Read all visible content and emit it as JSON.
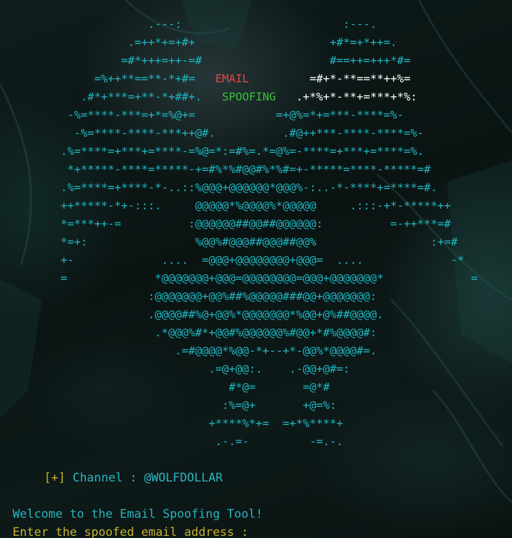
{
  "terminal": {
    "art_lines": [
      {
        "parts": [
          {
            "text": "                      .---:                        :---.",
            "cls": ""
          }
        ]
      },
      {
        "parts": [
          {
            "text": "                   .=++*+=+#+                    +#*=+*++=.",
            "cls": ""
          }
        ]
      },
      {
        "parts": [
          {
            "text": "                  =#*+++=++-=#                   #==++=+++*#=",
            "cls": ""
          }
        ]
      },
      {
        "parts": [
          {
            "text": "              =%++**==**-*+#=   ",
            "cls": ""
          },
          {
            "text": "EMAIL",
            "cls": "red"
          },
          {
            "text": "         ",
            "cls": ""
          },
          {
            "text": "=#+*-**==**++%=",
            "cls": "white"
          }
        ]
      },
      {
        "parts": [
          {
            "text": "            .#*+***=+**-*+##+.   ",
            "cls": ""
          },
          {
            "text": "SPOOFING",
            "cls": "green"
          },
          {
            "text": "   ",
            "cls": ""
          },
          {
            "text": ".+*%+*-**+=***+*%:",
            "cls": "white"
          }
        ]
      },
      {
        "parts": [
          {
            "text": "          -%=****-***=+*=%@+=            =+@%=*+=***-****=%-",
            "cls": ""
          }
        ]
      },
      {
        "parts": [
          {
            "text": "           -%=****-****-***++@#.          .#@++***-****-****=%-",
            "cls": ""
          }
        ]
      },
      {
        "parts": [
          {
            "text": "         .%=****=+***+=****-=%@=*:=#%=.*=@%=-****=+***+=****=%.",
            "cls": ""
          }
        ]
      },
      {
        "parts": [
          {
            "text": "          *+*****-****=*****-+=#%*%#@@#%*%#=+-*****=****-*****=#",
            "cls": ""
          }
        ]
      },
      {
        "parts": [
          {
            "text": "         .%=****=+****-*-..::%@@@+@@@@@@*@@@%-:..-*-****+=****=#.",
            "cls": ""
          }
        ]
      },
      {
        "parts": [
          {
            "text": "         ++*****-*+-:::.     @@@@@*%@@@@%*@@@@@     .:::-+*-*****++",
            "cls": ""
          }
        ]
      },
      {
        "parts": [
          {
            "text": "         *=***++-=          :@@@@@@##@@##@@@@@@:          =-++***=#",
            "cls": ""
          }
        ]
      },
      {
        "parts": [
          {
            "text": "         *=+:                %@@%#@@@##@@@##@@%                 :+=#",
            "cls": ""
          }
        ]
      },
      {
        "parts": [
          {
            "text": "         +-             ....  =@@@+@@@@@@@@+@@@=  ....             -*",
            "cls": ""
          }
        ]
      },
      {
        "parts": [
          {
            "text": "         =             *@@@@@@@+@@@=@@@@@@@@=@@@+@@@@@@@*             =",
            "cls": ""
          }
        ]
      },
      {
        "parts": [
          {
            "text": "                      :@@@@@@@+@@%##%@@@@@###@@+@@@@@@@:",
            "cls": ""
          }
        ]
      },
      {
        "parts": [
          {
            "text": "                      .@@@@##%@+@@%*@@@@@@@*%@@+@%##@@@@.",
            "cls": ""
          }
        ]
      },
      {
        "parts": [
          {
            "text": "                       .*@@@%#*+@@#%@@@@@@%#@@+*#%@@@@#:",
            "cls": ""
          }
        ]
      },
      {
        "parts": [
          {
            "text": "                          .=#@@@@*%@@-*+--+*-@@%*@@@@#=.",
            "cls": ""
          }
        ]
      },
      {
        "parts": [
          {
            "text": "                               .=@+@@:.    .-@@+@#=:",
            "cls": ""
          }
        ]
      },
      {
        "parts": [
          {
            "text": "                                  #*@=       =@*#",
            "cls": ""
          }
        ]
      },
      {
        "parts": [
          {
            "text": "                                 :%=@+       +@=%:",
            "cls": ""
          }
        ]
      },
      {
        "parts": [
          {
            "text": "                               +****%*+=  =+*%****+",
            "cls": ""
          }
        ]
      },
      {
        "parts": [
          {
            "text": "                                .-.=-         -=.-.",
            "cls": ""
          }
        ]
      }
    ],
    "channel": {
      "bracket": "[+]",
      "text": " Channel : @WOLFDOLLAR"
    },
    "welcome": "Welcome to the Email Spoofing Tool!",
    "prompt": "Enter the spoofed email address : "
  }
}
